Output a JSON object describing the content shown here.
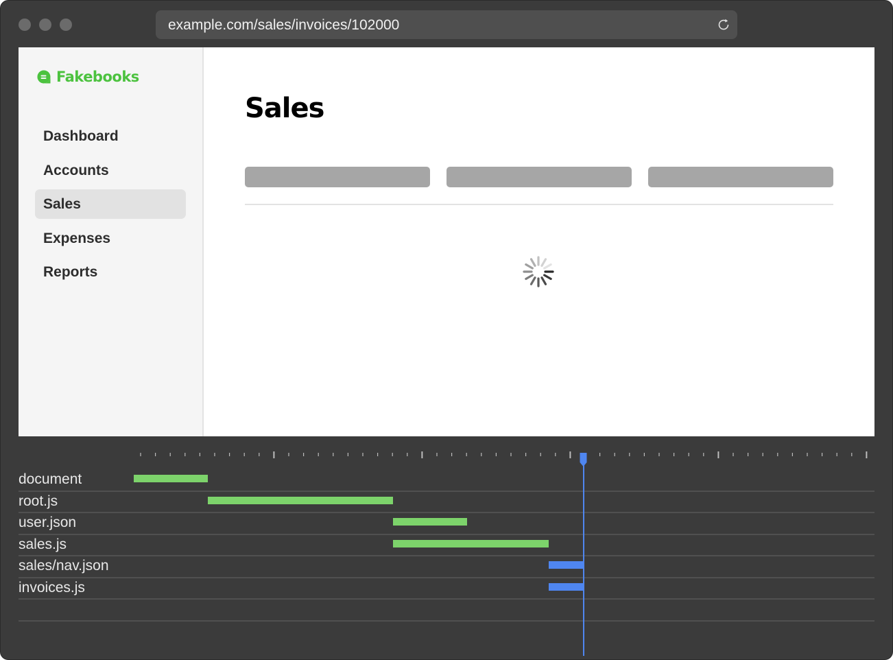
{
  "browser": {
    "url": "example.com/sales/invoices/102000"
  },
  "app": {
    "logo_text": "Fakebooks",
    "brand_color": "#4cc23f",
    "nav": [
      {
        "label": "Dashboard",
        "active": false
      },
      {
        "label": "Accounts",
        "active": false
      },
      {
        "label": "Sales",
        "active": true
      },
      {
        "label": "Expenses",
        "active": false
      },
      {
        "label": "Reports",
        "active": false
      }
    ],
    "page_title": "Sales",
    "loading": true
  },
  "network": {
    "requests": [
      {
        "name": "document",
        "start": 0.0,
        "end": 1.0,
        "color": "#7dd36b"
      },
      {
        "name": "root.js",
        "start": 1.0,
        "end": 3.5,
        "color": "#7dd36b"
      },
      {
        "name": "user.json",
        "start": 3.5,
        "end": 4.5,
        "color": "#7dd36b"
      },
      {
        "name": "sales.js",
        "start": 3.5,
        "end": 5.6,
        "color": "#7dd36b"
      },
      {
        "name": "sales/nav.json",
        "start": 5.6,
        "end": 6.07,
        "color": "#4f86f0"
      },
      {
        "name": "invoices.js",
        "start": 5.6,
        "end": 6.07,
        "color": "#4f86f0"
      }
    ],
    "playhead": 6.07,
    "playhead_color": "#4f86f0"
  }
}
